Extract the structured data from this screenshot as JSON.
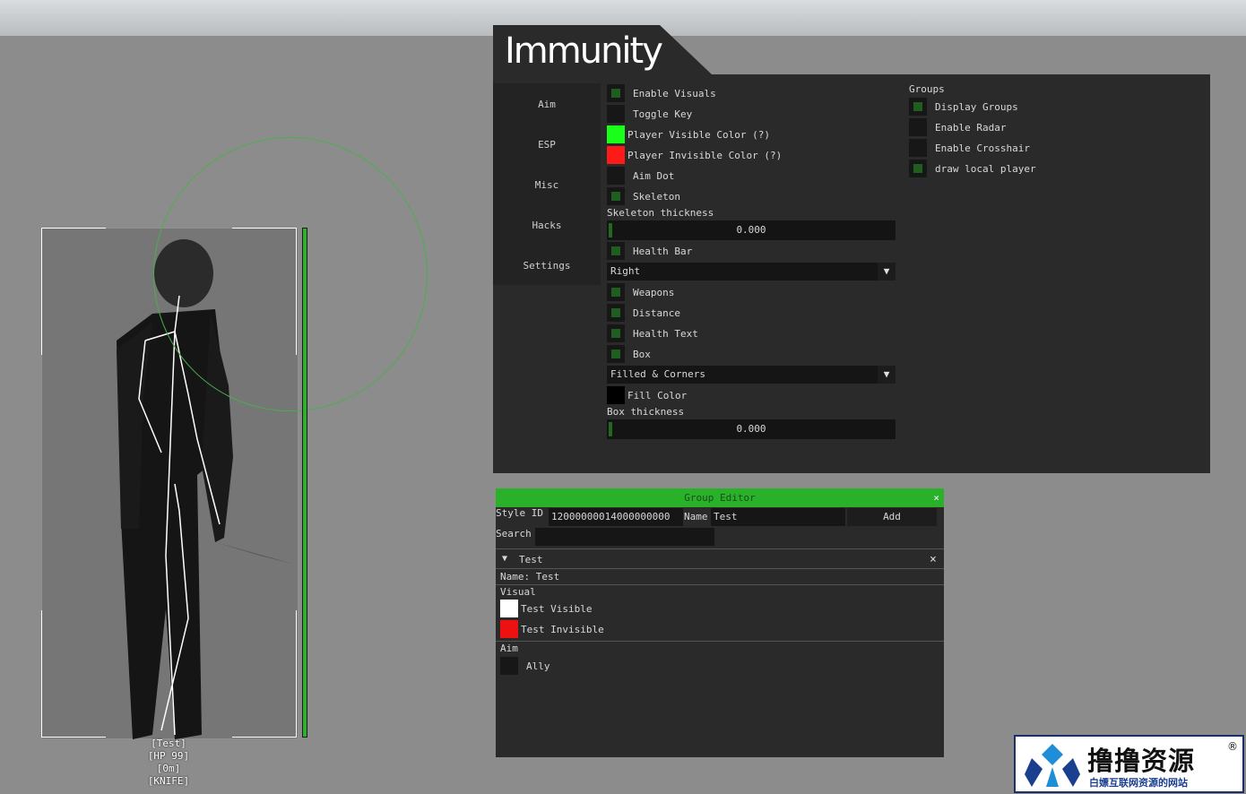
{
  "menu": {
    "logo": "Immunity",
    "nav": [
      "Aim",
      "ESP",
      "Misc",
      "Hacks",
      "Settings"
    ],
    "visuals": {
      "enable_visuals": "Enable Visuals",
      "toggle_key": "Toggle Key",
      "player_visible_color": "Player Visible Color (?)",
      "player_invisible_color": "Player Invisible Color (?)",
      "aim_dot": "Aim Dot",
      "skeleton": "Skeleton",
      "skeleton_thickness_label": "Skeleton thickness",
      "skeleton_thickness_value": "0.000",
      "health_bar": "Health Bar",
      "health_bar_position": "Right",
      "weapons": "Weapons",
      "distance": "Distance",
      "health_text": "Health Text",
      "box": "Box",
      "box_style": "Filled & Corners",
      "fill_color": "Fill Color",
      "box_thickness_label": "Box thickness",
      "box_thickness_value": "0.000"
    },
    "groups": {
      "header": "Groups",
      "display_groups": "Display Groups",
      "enable_radar": "Enable Radar",
      "enable_crosshair": "Enable Crosshair",
      "draw_local_player": "draw local player"
    },
    "colors": {
      "visible": "#1aff1a",
      "invisible": "#ff1a1a",
      "fill": "#000000"
    }
  },
  "group_editor": {
    "title": "Group Editor",
    "close": "×",
    "style_id_label": "Style ID",
    "style_id_value": "12000000014000000000",
    "name_label": "Name",
    "name_value": "Test",
    "add_button": "Add",
    "search_label": "Search",
    "search_value": "",
    "group": {
      "header": "Test",
      "arrow": "▼",
      "close": "×",
      "name_line": "Name: Test",
      "visual_label": "Visual",
      "test_visible": "Test Visible",
      "test_invisible": "Test Invisible",
      "aim_label": "Aim",
      "ally": "Ally"
    }
  },
  "esp": {
    "name": "[Test]",
    "hp": "[HP 99]",
    "distance": "[0m]",
    "weapon": "[KNIFE]"
  },
  "watermark": {
    "title": "撸撸资源",
    "subtitle": "白嫖互联网资源的网站",
    "registered": "®"
  }
}
